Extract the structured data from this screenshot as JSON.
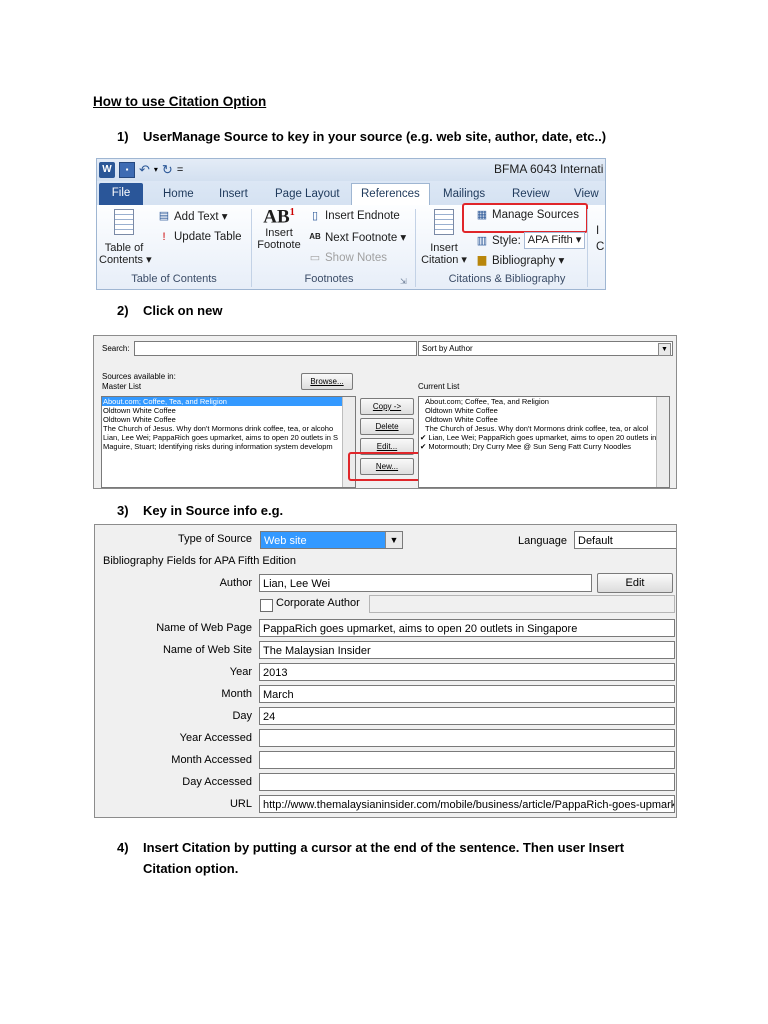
{
  "heading": "How to use Citation Option",
  "steps": [
    {
      "num": "1)",
      "text": "UserManage Source to key in your source (e.g. web site, author, date, etc..)"
    },
    {
      "num": "2)",
      "text": "Click on new"
    },
    {
      "num": "3)",
      "text": "Key in Source info e.g."
    },
    {
      "num": "4)",
      "text": "Insert Citation by putting a cursor at the end of the sentence. Then user Insert Citation option."
    }
  ],
  "ribbon": {
    "app_icon": "W",
    "undo_icon": "↶",
    "redo_icon": "↻",
    "qat_more": "=",
    "doc_title": "BFMA 6043 Internati",
    "tabs": [
      "File",
      "Home",
      "Insert",
      "Page Layout",
      "References",
      "Mailings",
      "Review",
      "View"
    ],
    "active_tab": "References",
    "toc": {
      "button": "Table of\nContents ▾",
      "add_text": "Add Text ▾",
      "update_table": "Update Table",
      "group": "Table of Contents"
    },
    "footnotes": {
      "ab_label": "AB",
      "ab_sup": "1",
      "insert_footnote": "Insert\nFootnote",
      "insert_endnote": "Insert Endnote",
      "next_footnote": "Next Footnote ▾",
      "show_notes": "Show Notes",
      "group": "Footnotes"
    },
    "citations": {
      "insert_citation": "Insert\nCitation ▾",
      "manage_sources": "Manage Sources",
      "style_label": "Style:",
      "style_value": "APA Fifth ▾",
      "bibliography": "Bibliography ▾",
      "group": "Citations & Bibliography"
    },
    "cut_captions": {
      "top": "I",
      "bottom": "C"
    },
    "accent": "#2a5699",
    "highlight": "#e0262a"
  },
  "source_manager": {
    "search_label": "Search:",
    "search_value": "",
    "sort_value": "Sort by Author",
    "available_label": "Sources available in:",
    "master_label": "Master List",
    "browse": "Browse...",
    "current_label": "Current List",
    "master_list": [
      "About.com; Coffee, Tea, and Religion",
      "Oldtown White Coffee",
      "Oldtown White Coffee",
      "The Church of Jesus. Why don't Mormons drink coffee, tea, or alcoho",
      "Lian, Lee Wei; PappaRich goes upmarket, aims to open 20 outlets in S",
      "Maguire, Stuart; Identifying risks during information system developm"
    ],
    "current_list": [
      "About.com; Coffee, Tea, and Religion",
      "Oldtown White Coffee",
      "Oldtown White Coffee",
      "The Church of Jesus. Why don't Mormons drink coffee, tea, or alcol",
      "✔ Lian, Lee Wei; PappaRich goes upmarket, aims to open 20 outlets in",
      "✔ Motormouth; Dry Curry Mee @ Sun Seng Fatt Curry Noodles"
    ],
    "copy": "Copy ->",
    "delete": "Delete",
    "edit": "Edit...",
    "new": "New..."
  },
  "source_form": {
    "type_label": "Type of Source",
    "type_value": "Web site",
    "language_label": "Language",
    "language_value": "Default",
    "fields_heading": "Bibliography Fields for APA Fifth Edition",
    "author_label": "Author",
    "author_value": "Lian, Lee Wei",
    "edit": "Edit",
    "corporate_label": "Corporate Author",
    "rows": [
      {
        "label": "Name of Web Page",
        "value": "PappaRich goes upmarket, aims to open 20 outlets in Singapore"
      },
      {
        "label": "Name of Web Site",
        "value": "The Malaysian Insider"
      },
      {
        "label": "Year",
        "value": "2013"
      },
      {
        "label": "Month",
        "value": "March"
      },
      {
        "label": "Day",
        "value": "24"
      },
      {
        "label": "Year Accessed",
        "value": ""
      },
      {
        "label": "Month Accessed",
        "value": ""
      },
      {
        "label": "Day Accessed",
        "value": ""
      },
      {
        "label": "URL",
        "value": "http://www.themalaysianinsider.com/mobile/business/article/PappaRich-goes-upmarket-a"
      }
    ]
  }
}
